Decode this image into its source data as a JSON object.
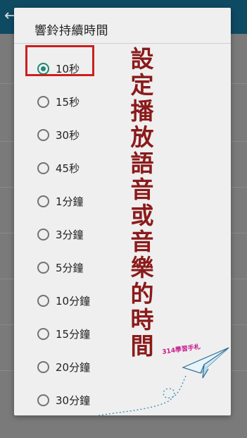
{
  "dialog": {
    "title": "響鈴持續時間",
    "options": [
      {
        "label": "10秒",
        "selected": true
      },
      {
        "label": "15秒",
        "selected": false
      },
      {
        "label": "30秒",
        "selected": false
      },
      {
        "label": "45秒",
        "selected": false
      },
      {
        "label": "1分鐘",
        "selected": false
      },
      {
        "label": "3分鐘",
        "selected": false
      },
      {
        "label": "5分鐘",
        "selected": false
      },
      {
        "label": "10分鐘",
        "selected": false
      },
      {
        "label": "15分鐘",
        "selected": false
      },
      {
        "label": "20分鐘",
        "selected": false
      },
      {
        "label": "30分鐘",
        "selected": false
      }
    ]
  },
  "annotation": {
    "text": "設定播放語音或音樂的時間",
    "color": "#8b1a1a",
    "highlight_color": "#cc1f1f"
  },
  "watermark": {
    "text": "314學習手札",
    "icon": "paper-plane-icon"
  },
  "colors": {
    "accent": "#1e8a76",
    "appbar": "#0f4a63"
  }
}
